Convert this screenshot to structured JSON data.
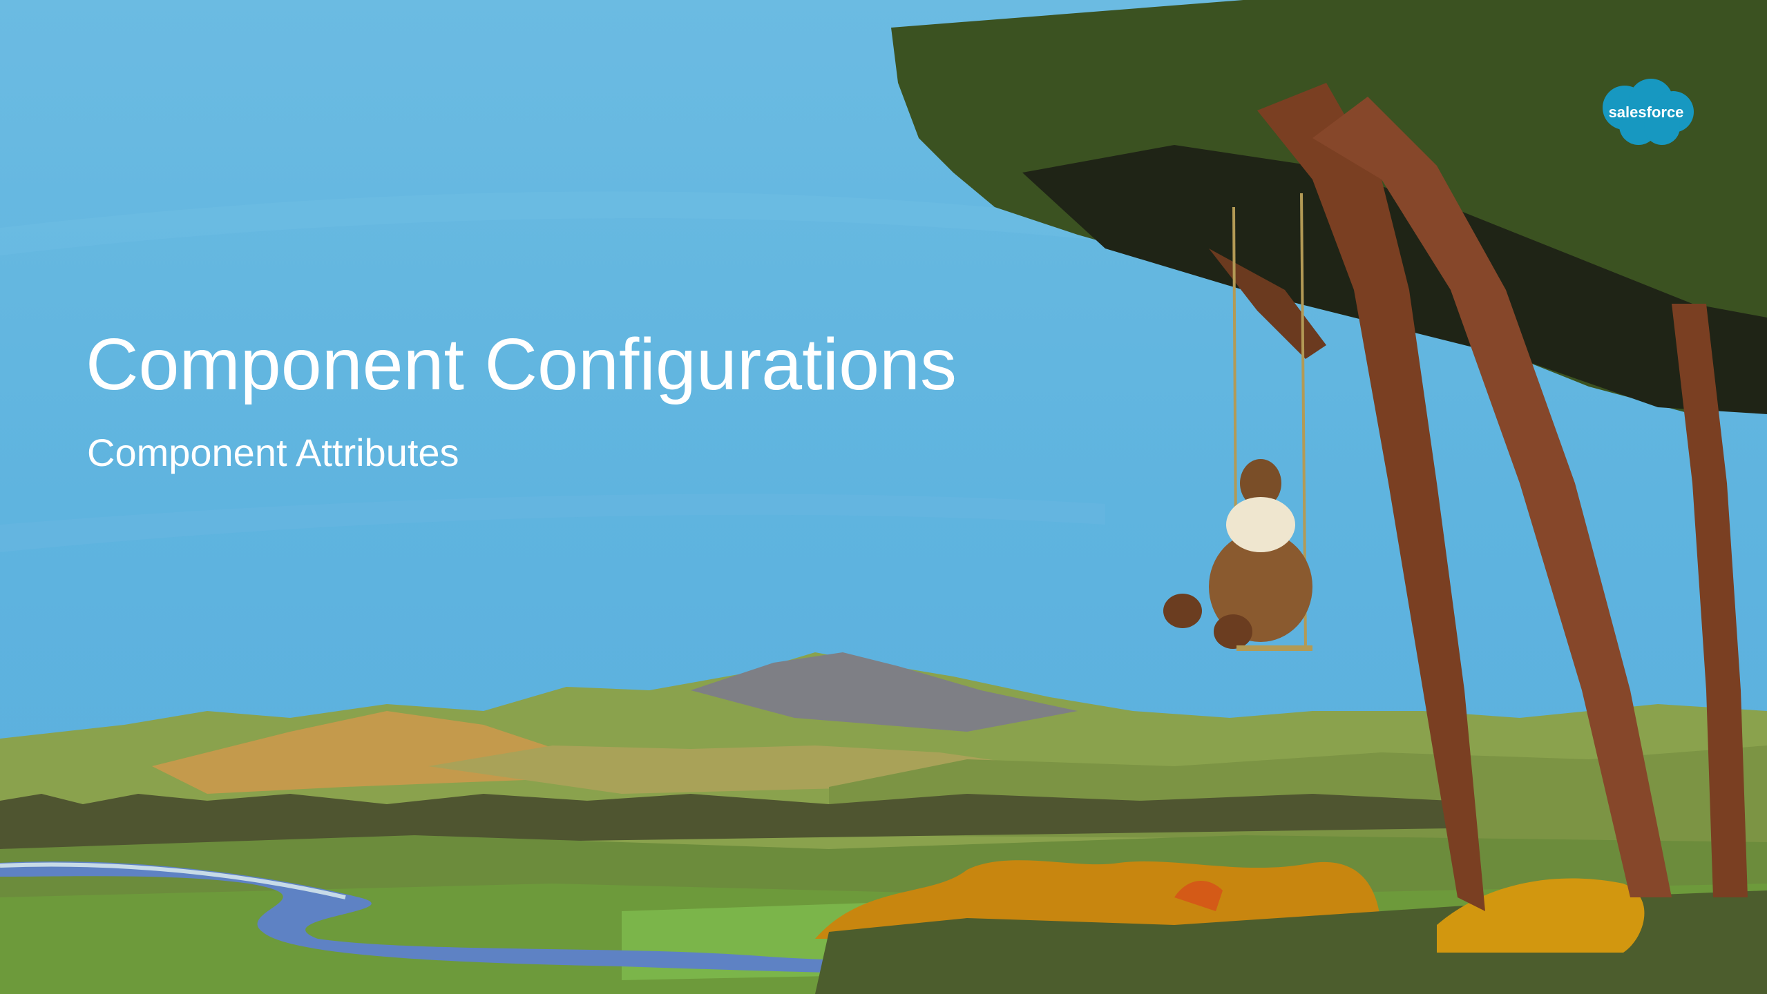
{
  "slide": {
    "title": "Component Configurations",
    "subtitle": "Component Attributes"
  },
  "logo": {
    "text": "salesforce",
    "color": "#1798c1"
  },
  "scene": {
    "sky_color": "#5fb4de",
    "foliage_color": "#3b5221",
    "trunk_color": "#7a3f22",
    "hill_color": "#8aa24d",
    "river_color": "#5e82c4",
    "icons": [
      "tree-icon",
      "bear-on-swing-icon",
      "mountain-icon",
      "river-icon"
    ]
  }
}
